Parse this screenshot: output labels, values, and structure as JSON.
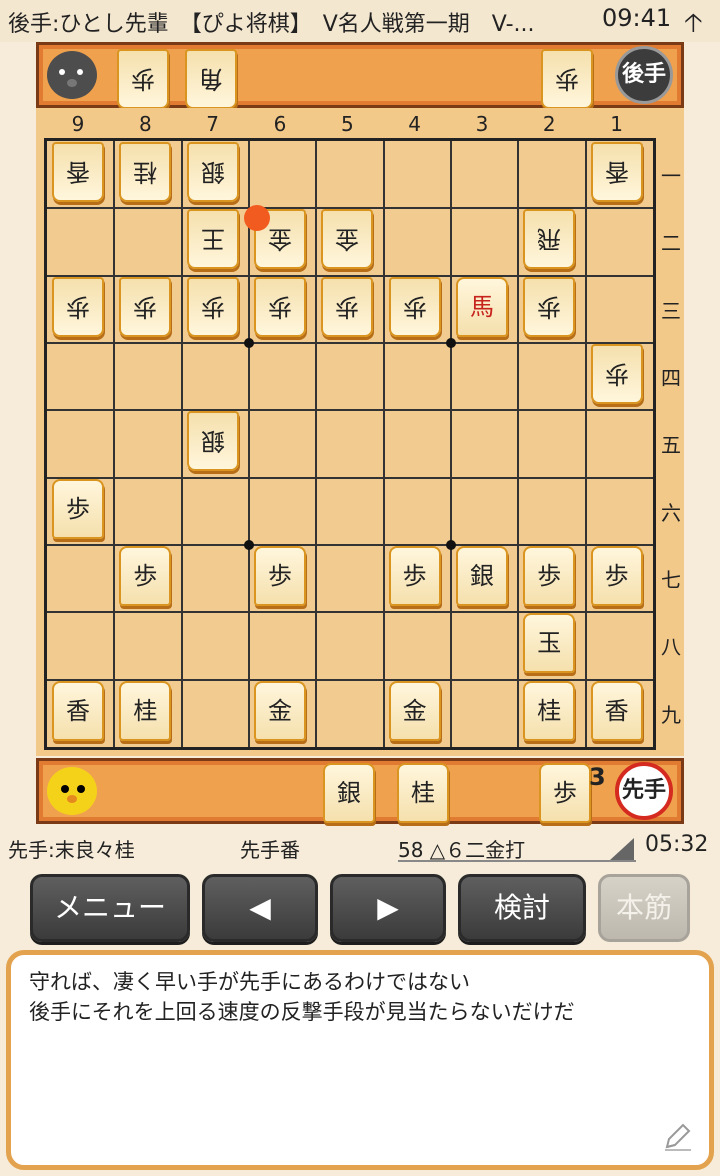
{
  "status_bar": {
    "title": "後手:ひとし先輩　【ぴよ将棋】　V名人戦第一期　V-...",
    "clock": "09:41",
    "arrow": "🡡"
  },
  "gote_hand": {
    "pieces": [
      "歩",
      "角",
      "歩"
    ],
    "badge": "後手"
  },
  "sente_hand": {
    "pieces": [
      "銀",
      "桂",
      "歩"
    ],
    "pawn_count": "3",
    "badge": "先手"
  },
  "board": {
    "files": [
      "9",
      "8",
      "7",
      "6",
      "5",
      "4",
      "3",
      "2",
      "1"
    ],
    "ranks": [
      "一",
      "二",
      "三",
      "四",
      "五",
      "六",
      "七",
      "八",
      "九"
    ],
    "pieces": [
      {
        "file": 9,
        "rank": 1,
        "label": "香",
        "side": "gote"
      },
      {
        "file": 8,
        "rank": 1,
        "label": "桂",
        "side": "gote"
      },
      {
        "file": 7,
        "rank": 1,
        "label": "銀",
        "side": "gote"
      },
      {
        "file": 1,
        "rank": 1,
        "label": "香",
        "side": "gote"
      },
      {
        "file": 7,
        "rank": 2,
        "label": "王",
        "side": "gote"
      },
      {
        "file": 6,
        "rank": 2,
        "label": "金",
        "side": "gote"
      },
      {
        "file": 5,
        "rank": 2,
        "label": "金",
        "side": "gote"
      },
      {
        "file": 2,
        "rank": 2,
        "label": "飛",
        "side": "gote"
      },
      {
        "file": 9,
        "rank": 3,
        "label": "歩",
        "side": "gote"
      },
      {
        "file": 8,
        "rank": 3,
        "label": "歩",
        "side": "gote"
      },
      {
        "file": 7,
        "rank": 3,
        "label": "歩",
        "side": "gote"
      },
      {
        "file": 6,
        "rank": 3,
        "label": "歩",
        "side": "gote"
      },
      {
        "file": 5,
        "rank": 3,
        "label": "歩",
        "side": "gote"
      },
      {
        "file": 4,
        "rank": 3,
        "label": "歩",
        "side": "gote"
      },
      {
        "file": 3,
        "rank": 3,
        "label": "馬",
        "side": "sente",
        "promoted": true
      },
      {
        "file": 2,
        "rank": 3,
        "label": "歩",
        "side": "gote"
      },
      {
        "file": 1,
        "rank": 4,
        "label": "歩",
        "side": "gote"
      },
      {
        "file": 7,
        "rank": 5,
        "label": "銀",
        "side": "gote"
      },
      {
        "file": 9,
        "rank": 6,
        "label": "歩",
        "side": "sente"
      },
      {
        "file": 8,
        "rank": 7,
        "label": "歩",
        "side": "sente"
      },
      {
        "file": 6,
        "rank": 7,
        "label": "歩",
        "side": "sente"
      },
      {
        "file": 4,
        "rank": 7,
        "label": "歩",
        "side": "sente"
      },
      {
        "file": 3,
        "rank": 7,
        "label": "銀",
        "side": "sente"
      },
      {
        "file": 2,
        "rank": 7,
        "label": "歩",
        "side": "sente"
      },
      {
        "file": 1,
        "rank": 7,
        "label": "歩",
        "side": "sente"
      },
      {
        "file": 2,
        "rank": 8,
        "label": "玉",
        "side": "sente"
      },
      {
        "file": 9,
        "rank": 9,
        "label": "香",
        "side": "sente"
      },
      {
        "file": 8,
        "rank": 9,
        "label": "桂",
        "side": "sente"
      },
      {
        "file": 6,
        "rank": 9,
        "label": "金",
        "side": "sente"
      },
      {
        "file": 4,
        "rank": 9,
        "label": "金",
        "side": "sente"
      },
      {
        "file": 2,
        "rank": 9,
        "label": "桂",
        "side": "sente"
      },
      {
        "file": 1,
        "rank": 9,
        "label": "香",
        "side": "sente"
      }
    ],
    "last_move_dot": {
      "file": 6,
      "rank": 2
    }
  },
  "info": {
    "sente_player": "先手:末良々桂",
    "turn": "先手番",
    "move": "58 △６二金打",
    "time": "05:32"
  },
  "buttons": {
    "menu": "メニュー",
    "prev": "◀",
    "next": "▶",
    "analyze": "検討",
    "mainline": "本筋"
  },
  "comment": {
    "text": "守れば、凄く早い手が先手にあるわけではない\n後手にそれを上回る速度の反撃手段が見当たらないだけだ"
  },
  "colors": {
    "hand_bar": "#e07b31",
    "board": "#f1cb90",
    "promoted_text": "#c7231d",
    "last_move": "#f25b1f",
    "comment_border": "#e3a24d"
  }
}
